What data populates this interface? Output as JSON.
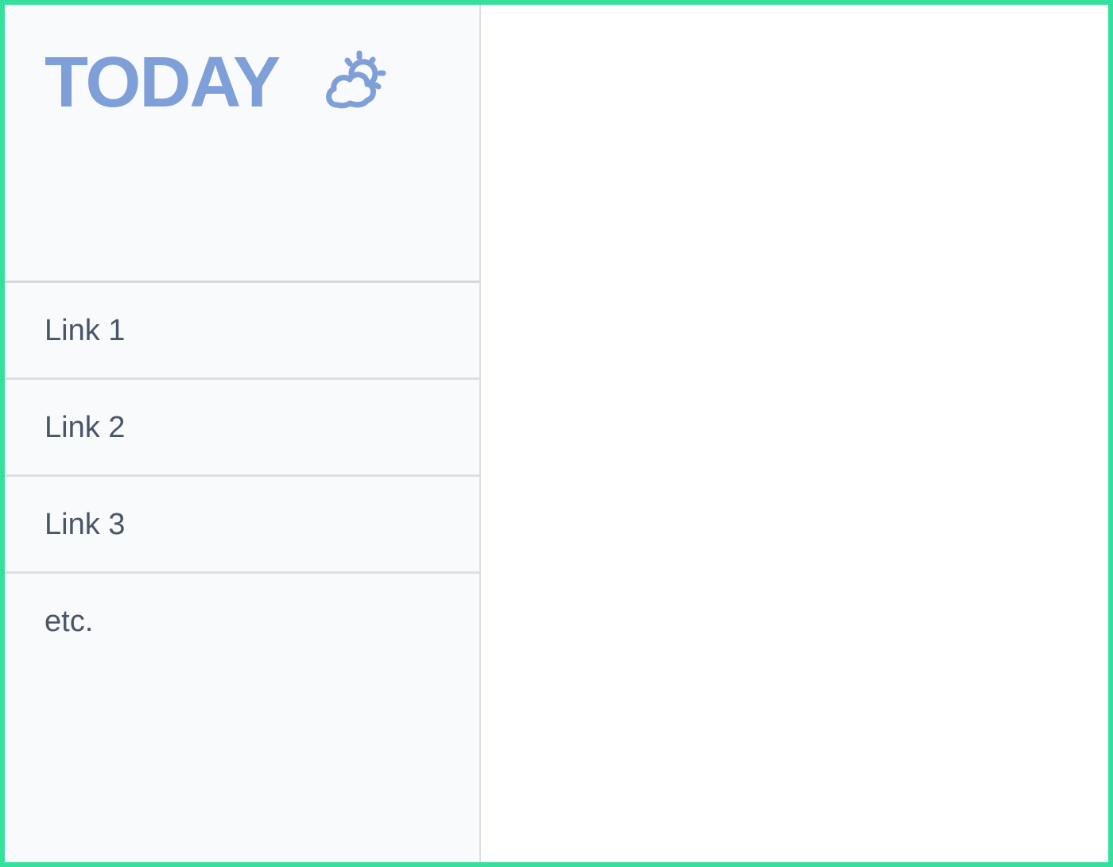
{
  "sidebar": {
    "brand": {
      "title": "TODAY",
      "icon": "sun-cloud-icon",
      "color": "#7e9fd7"
    },
    "links": [
      {
        "label": "Link 1"
      },
      {
        "label": "Link 2"
      },
      {
        "label": "Link 3"
      },
      {
        "label": "etc."
      }
    ]
  },
  "colors": {
    "frame_border": "#34e09b",
    "sidebar_bg": "#f8fafc",
    "link_text": "#4a5568"
  }
}
